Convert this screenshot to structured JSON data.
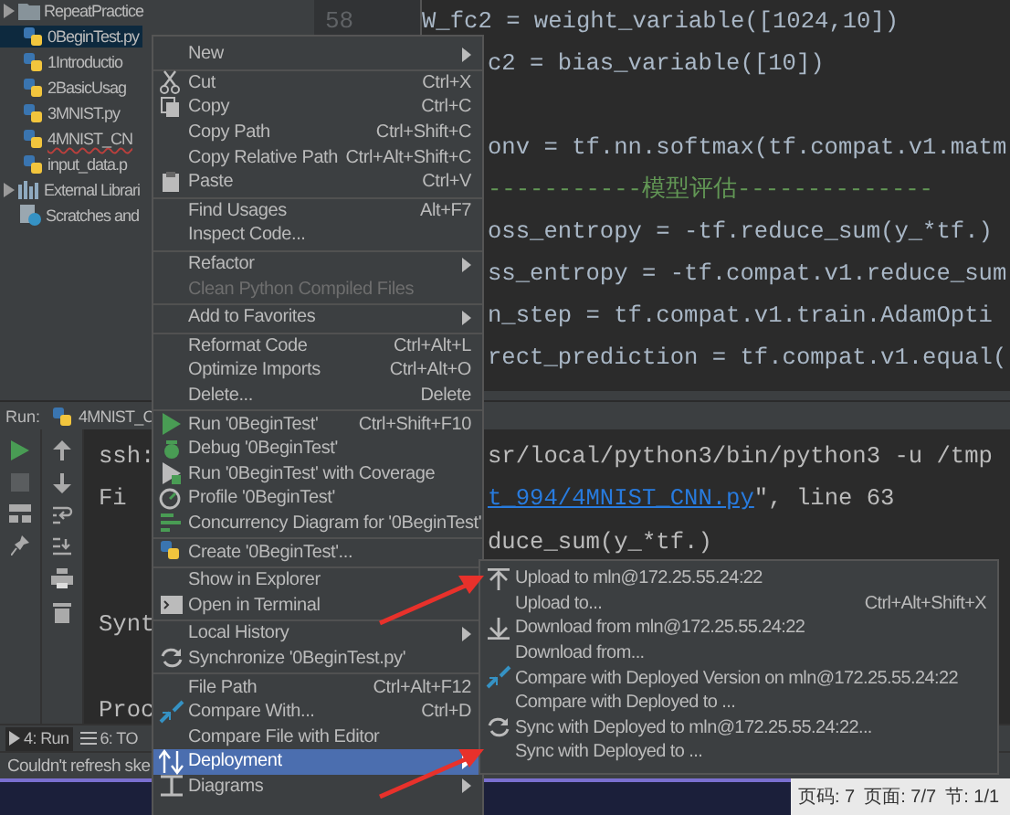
{
  "project_tree": {
    "items": [
      {
        "label": "RepeatPractice",
        "kind": "folder",
        "selected": false,
        "error": false
      },
      {
        "label": "0BeginTest.py",
        "kind": "python",
        "selected": true,
        "error": false
      },
      {
        "label": "1Introductio",
        "kind": "python",
        "selected": false,
        "error": false
      },
      {
        "label": "2BasicUsag",
        "kind": "python",
        "selected": false,
        "error": false
      },
      {
        "label": "3MNIST.py",
        "kind": "python",
        "selected": false,
        "error": false
      },
      {
        "label": "4MNIST_CN",
        "kind": "python",
        "selected": false,
        "error": true
      },
      {
        "label": "input_data.p",
        "kind": "python",
        "selected": false,
        "error": false
      },
      {
        "label": "External Librari",
        "kind": "library",
        "selected": false,
        "error": false
      },
      {
        "label": "Scratches and",
        "kind": "scratch",
        "selected": false,
        "error": false
      }
    ]
  },
  "editor": {
    "line_number": "58",
    "lines": [
      {
        "text": "W_fc2 = weight_variable([1024,10])",
        "kind": "code",
        "full": true
      },
      {
        "text": "c2 = bias_variable([10])",
        "kind": "code",
        "full": false
      },
      {
        "text": "onv = tf.nn.softmax(tf.compat.v1.matm",
        "kind": "code",
        "full": false
      },
      {
        "text": "-----------模型评估--------------",
        "kind": "comment",
        "full": false
      },
      {
        "text": "oss_entropy = -tf.reduce_sum(y_*tf.)",
        "kind": "code",
        "full": false
      },
      {
        "text": "ss_entropy = -tf.compat.v1.reduce_sum",
        "kind": "code",
        "full": false
      },
      {
        "text": "n_step = tf.compat.v1.train.AdamOpti",
        "kind": "code",
        "full": false
      },
      {
        "text": "rect_prediction = tf.compat.v1.equal(",
        "kind": "code",
        "full": false
      }
    ]
  },
  "run_panel": {
    "label": "Run:",
    "tab": "4MNIST_C",
    "console_left": [
      "ssh:",
      "Fi",
      "Synt",
      "Proc"
    ],
    "console_right": [
      {
        "text": "sr/local/python3/bin/python3 -u /tmp"
      },
      {
        "link": "t_994/4MNIST_CNN.py",
        "text": "\", line 63"
      },
      {
        "text": "duce_sum(y_*tf.)"
      }
    ]
  },
  "tool_tabs": [
    {
      "label": "4: Run",
      "selected": true
    },
    {
      "label": "6: TO",
      "selected": false
    }
  ],
  "status_bar": "Couldn't refresh ske",
  "word_status": [
    "页码: 7",
    "页面: 7/7",
    "节: 1/1"
  ],
  "context_menu": {
    "items": [
      {
        "label": "New",
        "submenu": true,
        "disabled": false,
        "selected": false,
        "separator_before": false
      },
      {
        "label": "Cut",
        "shortcut": "Ctrl+X",
        "submenu": false,
        "disabled": false,
        "selected": false,
        "separator_before": true
      },
      {
        "label": "Copy",
        "shortcut": "Ctrl+C",
        "submenu": false,
        "disabled": false,
        "selected": false,
        "separator_before": false
      },
      {
        "label": "Copy Path",
        "shortcut": "Ctrl+Shift+C",
        "submenu": false,
        "disabled": false,
        "selected": false,
        "separator_before": false
      },
      {
        "label": "Copy Relative Path",
        "shortcut": "Ctrl+Alt+Shift+C",
        "submenu": false,
        "disabled": false,
        "selected": false,
        "separator_before": false
      },
      {
        "label": "Paste",
        "shortcut": "Ctrl+V",
        "submenu": false,
        "disabled": false,
        "selected": false,
        "separator_before": false
      },
      {
        "label": "Find Usages",
        "shortcut": "Alt+F7",
        "submenu": false,
        "disabled": false,
        "selected": false,
        "separator_before": true
      },
      {
        "label": "Inspect Code...",
        "submenu": false,
        "disabled": false,
        "selected": false,
        "separator_before": false
      },
      {
        "label": "Refactor",
        "submenu": true,
        "disabled": false,
        "selected": false,
        "separator_before": true
      },
      {
        "label": "Clean Python Compiled Files",
        "submenu": false,
        "disabled": true,
        "selected": false,
        "separator_before": false
      },
      {
        "label": "Add to Favorites",
        "submenu": true,
        "disabled": false,
        "selected": false,
        "separator_before": true
      },
      {
        "label": "Reformat Code",
        "shortcut": "Ctrl+Alt+L",
        "submenu": false,
        "disabled": false,
        "selected": false,
        "separator_before": true
      },
      {
        "label": "Optimize Imports",
        "shortcut": "Ctrl+Alt+O",
        "submenu": false,
        "disabled": false,
        "selected": false,
        "separator_before": false
      },
      {
        "label": "Delete...",
        "shortcut": "Delete",
        "submenu": false,
        "disabled": false,
        "selected": false,
        "separator_before": false
      },
      {
        "label": "Run '0BeginTest'",
        "shortcut": "Ctrl+Shift+F10",
        "submenu": false,
        "disabled": false,
        "selected": false,
        "separator_before": true
      },
      {
        "label": "Debug '0BeginTest'",
        "submenu": false,
        "disabled": false,
        "selected": false,
        "separator_before": false
      },
      {
        "label": "Run '0BeginTest' with Coverage",
        "submenu": false,
        "disabled": false,
        "selected": false,
        "separator_before": false
      },
      {
        "label": "Profile '0BeginTest'",
        "submenu": false,
        "disabled": false,
        "selected": false,
        "separator_before": false
      },
      {
        "label": "Concurrency Diagram for '0BeginTest'",
        "submenu": false,
        "disabled": false,
        "selected": false,
        "separator_before": false
      },
      {
        "label": "Create '0BeginTest'...",
        "submenu": false,
        "disabled": false,
        "selected": false,
        "separator_before": true
      },
      {
        "label": "Show in Explorer",
        "submenu": false,
        "disabled": false,
        "selected": false,
        "separator_before": true
      },
      {
        "label": "Open in Terminal",
        "submenu": false,
        "disabled": false,
        "selected": false,
        "separator_before": false
      },
      {
        "label": "Local History",
        "submenu": true,
        "disabled": false,
        "selected": false,
        "separator_before": true
      },
      {
        "label": "Synchronize '0BeginTest.py'",
        "submenu": false,
        "disabled": false,
        "selected": false,
        "separator_before": false
      },
      {
        "label": "File Path",
        "shortcut": "Ctrl+Alt+F12",
        "submenu": false,
        "disabled": false,
        "selected": false,
        "separator_before": true
      },
      {
        "label": "Compare With...",
        "shortcut": "Ctrl+D",
        "submenu": false,
        "disabled": false,
        "selected": false,
        "separator_before": false
      },
      {
        "label": "Compare File with Editor",
        "submenu": false,
        "disabled": false,
        "selected": false,
        "separator_before": false
      },
      {
        "label": "Deployment",
        "submenu": true,
        "disabled": false,
        "selected": true,
        "separator_before": false
      },
      {
        "label": "Diagrams",
        "submenu": true,
        "disabled": false,
        "selected": false,
        "separator_before": false
      }
    ]
  },
  "deployment_submenu": {
    "items": [
      {
        "label": "Upload to mln@172.25.55.24:22"
      },
      {
        "label": "Upload to...",
        "shortcut": "Ctrl+Alt+Shift+X"
      },
      {
        "label": "Download from mln@172.25.55.24:22"
      },
      {
        "label": "Download from..."
      },
      {
        "label": "Compare with Deployed Version on mln@172.25.55.24:22"
      },
      {
        "label": "Compare with Deployed to ..."
      },
      {
        "label": "Sync with Deployed to mln@172.25.55.24:22..."
      },
      {
        "label": "Sync with Deployed to ..."
      }
    ]
  }
}
